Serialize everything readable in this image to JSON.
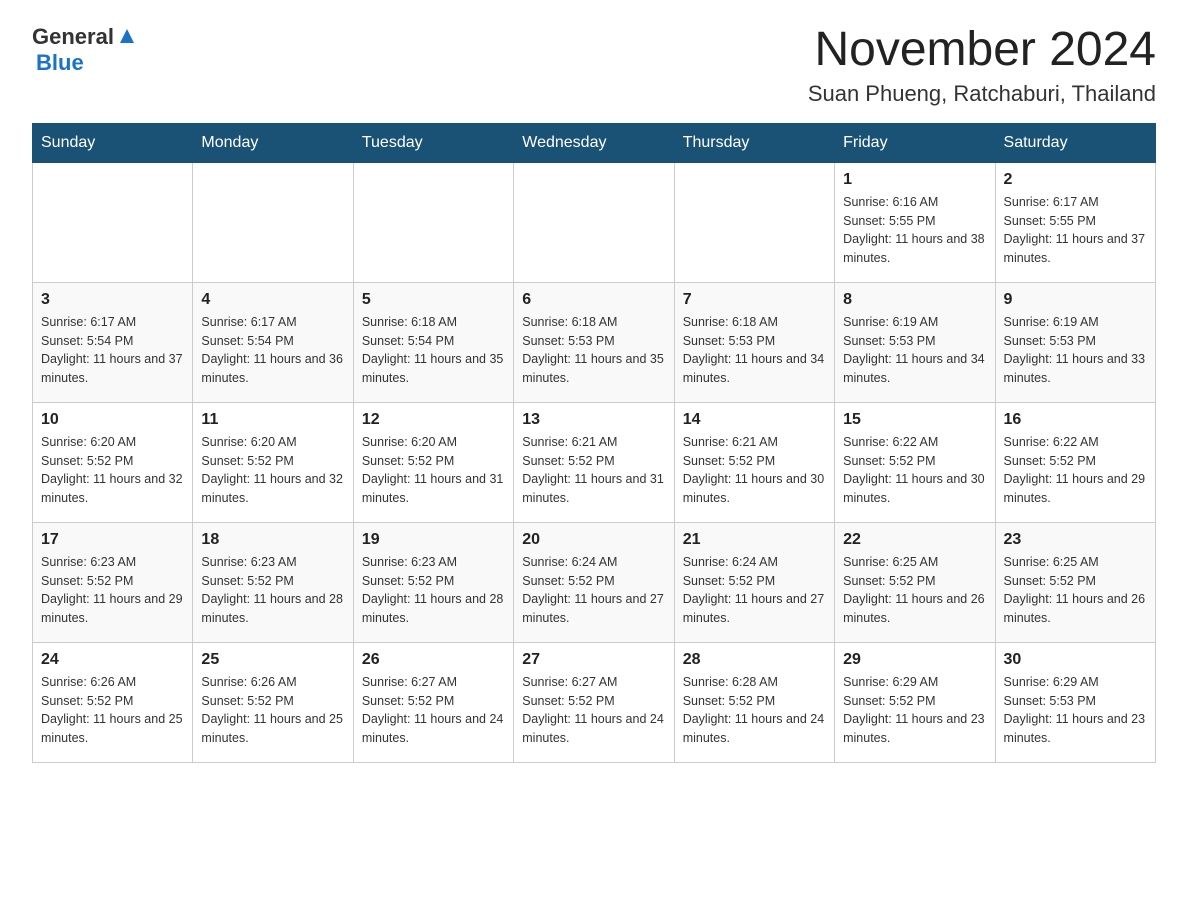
{
  "header": {
    "logo_general": "General",
    "logo_blue": "Blue",
    "month_title": "November 2024",
    "location": "Suan Phueng, Ratchaburi, Thailand"
  },
  "calendar": {
    "days_of_week": [
      "Sunday",
      "Monday",
      "Tuesday",
      "Wednesday",
      "Thursday",
      "Friday",
      "Saturday"
    ],
    "weeks": [
      [
        {
          "day": "",
          "info": ""
        },
        {
          "day": "",
          "info": ""
        },
        {
          "day": "",
          "info": ""
        },
        {
          "day": "",
          "info": ""
        },
        {
          "day": "",
          "info": ""
        },
        {
          "day": "1",
          "info": "Sunrise: 6:16 AM\nSunset: 5:55 PM\nDaylight: 11 hours and 38 minutes."
        },
        {
          "day": "2",
          "info": "Sunrise: 6:17 AM\nSunset: 5:55 PM\nDaylight: 11 hours and 37 minutes."
        }
      ],
      [
        {
          "day": "3",
          "info": "Sunrise: 6:17 AM\nSunset: 5:54 PM\nDaylight: 11 hours and 37 minutes."
        },
        {
          "day": "4",
          "info": "Sunrise: 6:17 AM\nSunset: 5:54 PM\nDaylight: 11 hours and 36 minutes."
        },
        {
          "day": "5",
          "info": "Sunrise: 6:18 AM\nSunset: 5:54 PM\nDaylight: 11 hours and 35 minutes."
        },
        {
          "day": "6",
          "info": "Sunrise: 6:18 AM\nSunset: 5:53 PM\nDaylight: 11 hours and 35 minutes."
        },
        {
          "day": "7",
          "info": "Sunrise: 6:18 AM\nSunset: 5:53 PM\nDaylight: 11 hours and 34 minutes."
        },
        {
          "day": "8",
          "info": "Sunrise: 6:19 AM\nSunset: 5:53 PM\nDaylight: 11 hours and 34 minutes."
        },
        {
          "day": "9",
          "info": "Sunrise: 6:19 AM\nSunset: 5:53 PM\nDaylight: 11 hours and 33 minutes."
        }
      ],
      [
        {
          "day": "10",
          "info": "Sunrise: 6:20 AM\nSunset: 5:52 PM\nDaylight: 11 hours and 32 minutes."
        },
        {
          "day": "11",
          "info": "Sunrise: 6:20 AM\nSunset: 5:52 PM\nDaylight: 11 hours and 32 minutes."
        },
        {
          "day": "12",
          "info": "Sunrise: 6:20 AM\nSunset: 5:52 PM\nDaylight: 11 hours and 31 minutes."
        },
        {
          "day": "13",
          "info": "Sunrise: 6:21 AM\nSunset: 5:52 PM\nDaylight: 11 hours and 31 minutes."
        },
        {
          "day": "14",
          "info": "Sunrise: 6:21 AM\nSunset: 5:52 PM\nDaylight: 11 hours and 30 minutes."
        },
        {
          "day": "15",
          "info": "Sunrise: 6:22 AM\nSunset: 5:52 PM\nDaylight: 11 hours and 30 minutes."
        },
        {
          "day": "16",
          "info": "Sunrise: 6:22 AM\nSunset: 5:52 PM\nDaylight: 11 hours and 29 minutes."
        }
      ],
      [
        {
          "day": "17",
          "info": "Sunrise: 6:23 AM\nSunset: 5:52 PM\nDaylight: 11 hours and 29 minutes."
        },
        {
          "day": "18",
          "info": "Sunrise: 6:23 AM\nSunset: 5:52 PM\nDaylight: 11 hours and 28 minutes."
        },
        {
          "day": "19",
          "info": "Sunrise: 6:23 AM\nSunset: 5:52 PM\nDaylight: 11 hours and 28 minutes."
        },
        {
          "day": "20",
          "info": "Sunrise: 6:24 AM\nSunset: 5:52 PM\nDaylight: 11 hours and 27 minutes."
        },
        {
          "day": "21",
          "info": "Sunrise: 6:24 AM\nSunset: 5:52 PM\nDaylight: 11 hours and 27 minutes."
        },
        {
          "day": "22",
          "info": "Sunrise: 6:25 AM\nSunset: 5:52 PM\nDaylight: 11 hours and 26 minutes."
        },
        {
          "day": "23",
          "info": "Sunrise: 6:25 AM\nSunset: 5:52 PM\nDaylight: 11 hours and 26 minutes."
        }
      ],
      [
        {
          "day": "24",
          "info": "Sunrise: 6:26 AM\nSunset: 5:52 PM\nDaylight: 11 hours and 25 minutes."
        },
        {
          "day": "25",
          "info": "Sunrise: 6:26 AM\nSunset: 5:52 PM\nDaylight: 11 hours and 25 minutes."
        },
        {
          "day": "26",
          "info": "Sunrise: 6:27 AM\nSunset: 5:52 PM\nDaylight: 11 hours and 24 minutes."
        },
        {
          "day": "27",
          "info": "Sunrise: 6:27 AM\nSunset: 5:52 PM\nDaylight: 11 hours and 24 minutes."
        },
        {
          "day": "28",
          "info": "Sunrise: 6:28 AM\nSunset: 5:52 PM\nDaylight: 11 hours and 24 minutes."
        },
        {
          "day": "29",
          "info": "Sunrise: 6:29 AM\nSunset: 5:52 PM\nDaylight: 11 hours and 23 minutes."
        },
        {
          "day": "30",
          "info": "Sunrise: 6:29 AM\nSunset: 5:53 PM\nDaylight: 11 hours and 23 minutes."
        }
      ]
    ]
  }
}
